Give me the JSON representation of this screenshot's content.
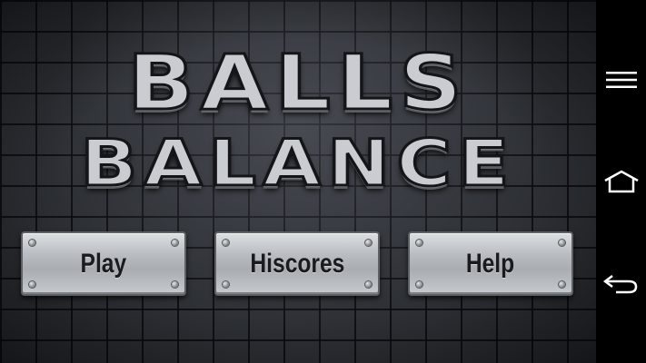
{
  "game": {
    "title_line1": "BALLS",
    "title_line2": "BALANCE"
  },
  "menu": {
    "play_label": "Play",
    "hiscores_label": "Hiscores",
    "help_label": "Help"
  },
  "navbar": {
    "icons": [
      "menu-icon",
      "home-icon",
      "back-icon"
    ],
    "icon_color": "#ffffff"
  },
  "colors": {
    "wall": "#2d3035",
    "plate": "#b9bdc2",
    "title": "#c9ccd0"
  }
}
